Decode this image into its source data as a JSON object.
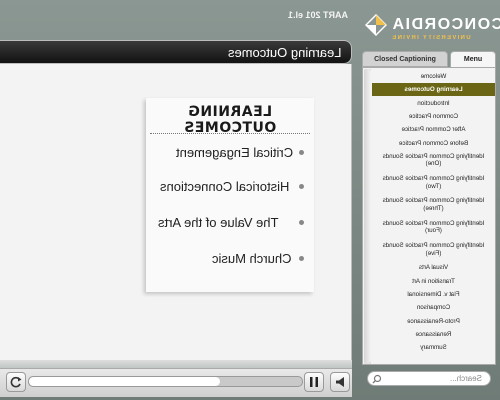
{
  "header": {
    "logo_name": "CONCORDIA",
    "logo_sub": "UNIVERSITY IRVINE",
    "course": "AART 201 el.1"
  },
  "slide": {
    "title": "Learning Outcomes",
    "heading": "LEARNING OUTCOMES",
    "outcomes": [
      "Critical Engagement",
      "Historical Connections",
      "The Value of the Arts",
      "Church Music"
    ]
  },
  "sidebar": {
    "tabs": {
      "menu": "Menu",
      "cc": "Closed Captioning"
    },
    "items": [
      "Welcome",
      "Learning Outcomes",
      "Introduction",
      "Common Practice",
      "After Common Practice",
      "Before Common Practice",
      "Identifying Common Practice Sounds (One)",
      "Identifying Common Practice Sounds (Two)",
      "Identifying Common Practice Sounds (Three)",
      "Identifying Common Practice Sounds (Four)",
      "Identifying Common Practice Sounds (Five)",
      "Visual Arts",
      "Transition in Art",
      "Flat v. Dimensional",
      "Comparison",
      "Proto-Renaissance",
      "Renaissance",
      "Summary"
    ],
    "active_index": 1,
    "search_placeholder": "Search..."
  },
  "player": {
    "progress": 0.7
  },
  "colors": {
    "accent": "#6b6616",
    "brand_gold": "#f0c04a"
  }
}
